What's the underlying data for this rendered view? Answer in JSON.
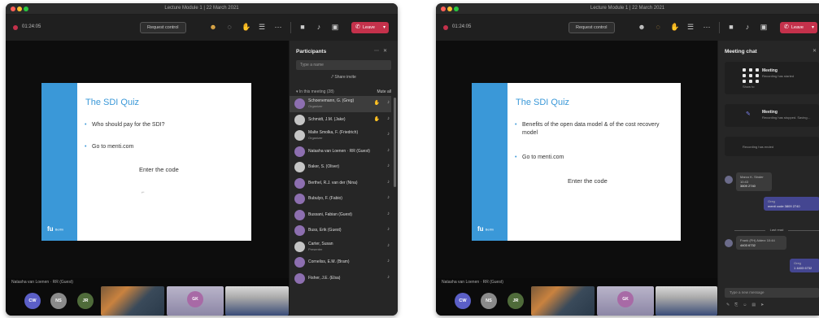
{
  "left": {
    "window_title": "Lecture Module 1 | 22 March 2021",
    "timer": "01:24:05",
    "request_control": "Request control",
    "leave": "Leave",
    "slide": {
      "title": "The SDI Quiz",
      "bullets": [
        "Who should pay for the SDI?",
        "Go to menti.com"
      ],
      "center": "Enter the code",
      "logo": "fu",
      "logo_small": "Berlin"
    },
    "presenter": "Natasha van Loenen · RR (Guest)",
    "avatars": [
      "CW",
      "NS",
      "JR"
    ],
    "video_pip": "GK",
    "participants": {
      "title": "Participants",
      "search_placeholder": "Type a name",
      "share_invite": "Share invite",
      "section": "In this meeting (28)",
      "mute_all": "Mute all",
      "people": [
        {
          "name": "Schoenemann, G. (Greg)",
          "sub": "Organizer",
          "hand": true
        },
        {
          "name": "Schmidt, J.M. (Jake)",
          "sub": "",
          "hand": true
        },
        {
          "name": "Malte Smolka, F. (Friedrich)",
          "sub": "Organizer",
          "hand": false
        },
        {
          "name": "Natasha van Loenen · RR (Guest)",
          "sub": "",
          "hand": false
        },
        {
          "name": "Baker, S. (Oliver)",
          "sub": "",
          "hand": false
        },
        {
          "name": "Berthel, R.J. van der (Nina)",
          "sub": "",
          "hand": false
        },
        {
          "name": "Bubulyo, F. (Fabio)",
          "sub": "",
          "hand": false
        },
        {
          "name": "Bussani, Fabian (Guest)",
          "sub": "",
          "hand": false
        },
        {
          "name": "Buss, Erik (Guest)",
          "sub": "",
          "hand": false
        },
        {
          "name": "Carter, Susan",
          "sub": "Presenter",
          "hand": false
        },
        {
          "name": "Corneliss, E.M. (Bram)",
          "sub": "",
          "hand": false
        },
        {
          "name": "Fisher, J.E. (Elsa)",
          "sub": "",
          "hand": false
        }
      ]
    }
  },
  "right": {
    "window_title": "Lecture Module 1 | 22 March 2021",
    "timer": "01:24:05",
    "request_control": "Request control",
    "leave": "Leave",
    "slide": {
      "title": "The SDI Quiz",
      "bullets": [
        "Benefits of the open data model & of the cost recovery model",
        "Go to menti.com"
      ],
      "center": "Enter the code",
      "logo": "fu",
      "logo_small": "Berlin"
    },
    "presenter": "Natasha van Loenen · RR (Guest)",
    "avatars": [
      "CW",
      "NS",
      "JR"
    ],
    "video_pip": "GK",
    "chat": {
      "title": "Meeting chat",
      "card1_title": "Meeting",
      "card1_sub": "Recording has started",
      "card1_label": "Show to",
      "card2_title": "Meeting",
      "card2_sub": "Recording has stopped. Saving…",
      "card3_sub": "Recording has ended",
      "msg1_name": "Marco K. Sinder",
      "msg1_time": "10:43",
      "msg1_text": "3809 2740",
      "msg2_name": "Greg",
      "msg2_text": "menti code 3809 2740",
      "last_read": "Last read",
      "msg3_name": "Frank (FH) Alderz",
      "msg3_time": "10:44",
      "msg3_text": "4403 6732",
      "msg4_name": "Greg",
      "msg4_text": "1 4403 6732",
      "compose_placeholder": "Type a new message"
    }
  }
}
